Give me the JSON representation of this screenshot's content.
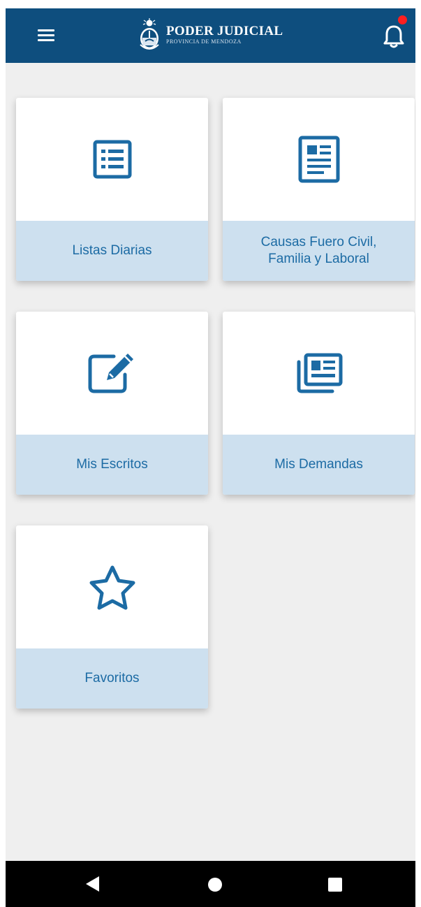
{
  "appbar": {
    "title": "PODER JUDICIAL",
    "subtitle": "PROVINCIA DE MENDOZA",
    "menu_icon": "hamburger-menu-icon",
    "notification_icon": "bell-icon",
    "notification_dot_color": "#ff1f1f",
    "background_color": "#0e4e7e"
  },
  "tiles": [
    {
      "label": "Listas Diarias",
      "icon": "list-icon"
    },
    {
      "label": "Causas Fuero Civil, Familia y Laboral",
      "icon": "document-icon"
    },
    {
      "label": "Mis Escritos",
      "icon": "edit-icon"
    },
    {
      "label": "Mis Demandas",
      "icon": "newspaper-icon"
    },
    {
      "label": "Favoritos",
      "icon": "star-icon"
    }
  ],
  "colors": {
    "accent": "#1c6ba4",
    "tile_label_bg": "#cde0ef",
    "page_bg": "#efefef"
  },
  "system_nav": {
    "back": "back-triangle-icon",
    "home": "home-circle-icon",
    "recent": "recent-apps-square-icon"
  }
}
